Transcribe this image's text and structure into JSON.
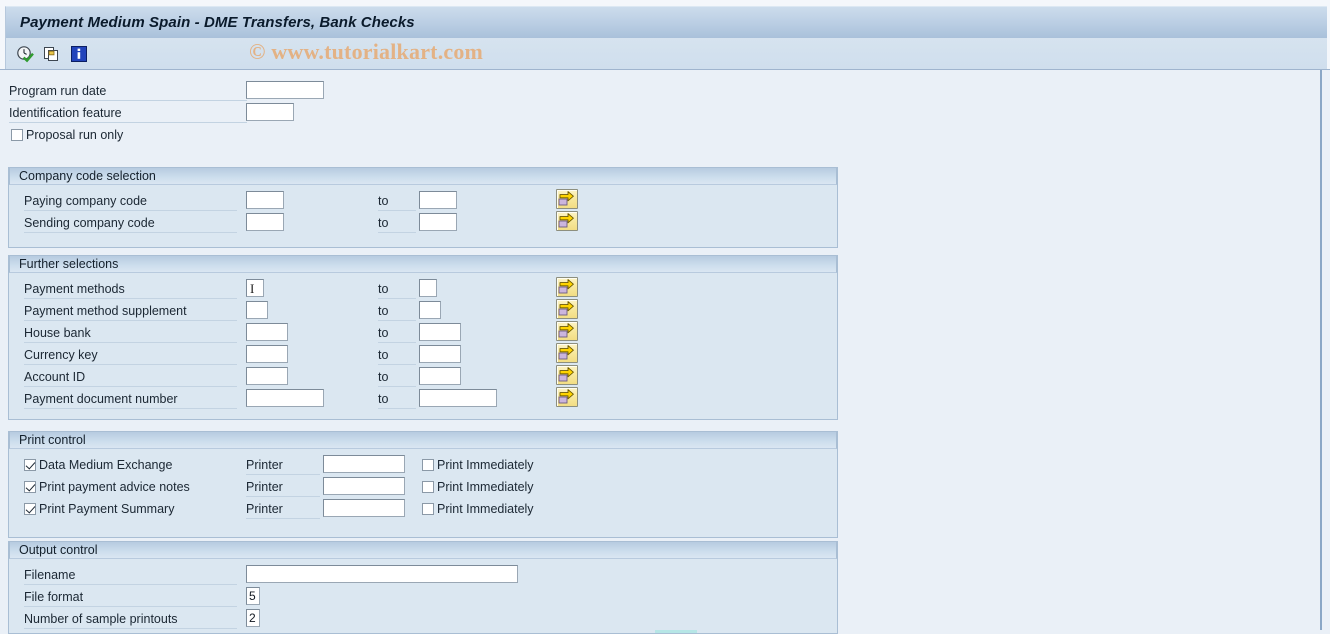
{
  "window": {
    "title": "Payment Medium Spain - DME Transfers, Bank Checks",
    "watermark": "© www.tutorialkart.com"
  },
  "toolbar": {
    "buttons": [
      {
        "name": "execute-icon",
        "tooltip": "Execute"
      },
      {
        "name": "copy-icon",
        "tooltip": "Copy"
      },
      {
        "name": "info-icon",
        "tooltip": "Information"
      }
    ]
  },
  "top_fields": {
    "program_run_date": {
      "label": "Program run date",
      "value": ""
    },
    "identification_feature": {
      "label": "Identification feature",
      "value": ""
    },
    "proposal_run_only": {
      "label": "Proposal run only",
      "checked": false
    }
  },
  "company_code_selection": {
    "header": "Company code selection",
    "to_label": "to",
    "rows": [
      {
        "label": "Paying company code",
        "from": "",
        "to": ""
      },
      {
        "label": "Sending company code",
        "from": "",
        "to": ""
      }
    ]
  },
  "further_selections": {
    "header": "Further selections",
    "to_label": "to",
    "rows": [
      {
        "label": "Payment methods",
        "from": "",
        "to": ""
      },
      {
        "label": "Payment method supplement",
        "from": "",
        "to": ""
      },
      {
        "label": "House bank",
        "from": "",
        "to": ""
      },
      {
        "label": "Currency key",
        "from": "",
        "to": ""
      },
      {
        "label": "Account ID",
        "from": "",
        "to": ""
      },
      {
        "label": "Payment document number",
        "from": "",
        "to": ""
      }
    ]
  },
  "print_control": {
    "header": "Print control",
    "printer_label": "Printer",
    "print_immediately_label": "Print Immediately",
    "rows": [
      {
        "label": "Data Medium Exchange",
        "checked": true,
        "printer": "",
        "print_immediately": false
      },
      {
        "label": "Print payment advice notes",
        "checked": true,
        "printer": "",
        "print_immediately": false
      },
      {
        "label": "Print Payment Summary",
        "checked": true,
        "printer": "",
        "print_immediately": false
      }
    ]
  },
  "output_control": {
    "header": "Output control",
    "rows": [
      {
        "label": "Filename",
        "value": ""
      },
      {
        "label": "File format",
        "value": "5"
      },
      {
        "label": "Number of sample printouts",
        "value": "2"
      }
    ]
  },
  "colors": {
    "page_background": "#eaf0f7",
    "panel_background": "#dbe7f1",
    "panel_border": "#a9bed4",
    "titlebar_gradient_top": "#ccdcec",
    "titlebar_gradient_bottom": "#a9c1da",
    "accent_yellow": "#f7e79a",
    "watermark": "#e3b285",
    "text": "#1b2733"
  }
}
